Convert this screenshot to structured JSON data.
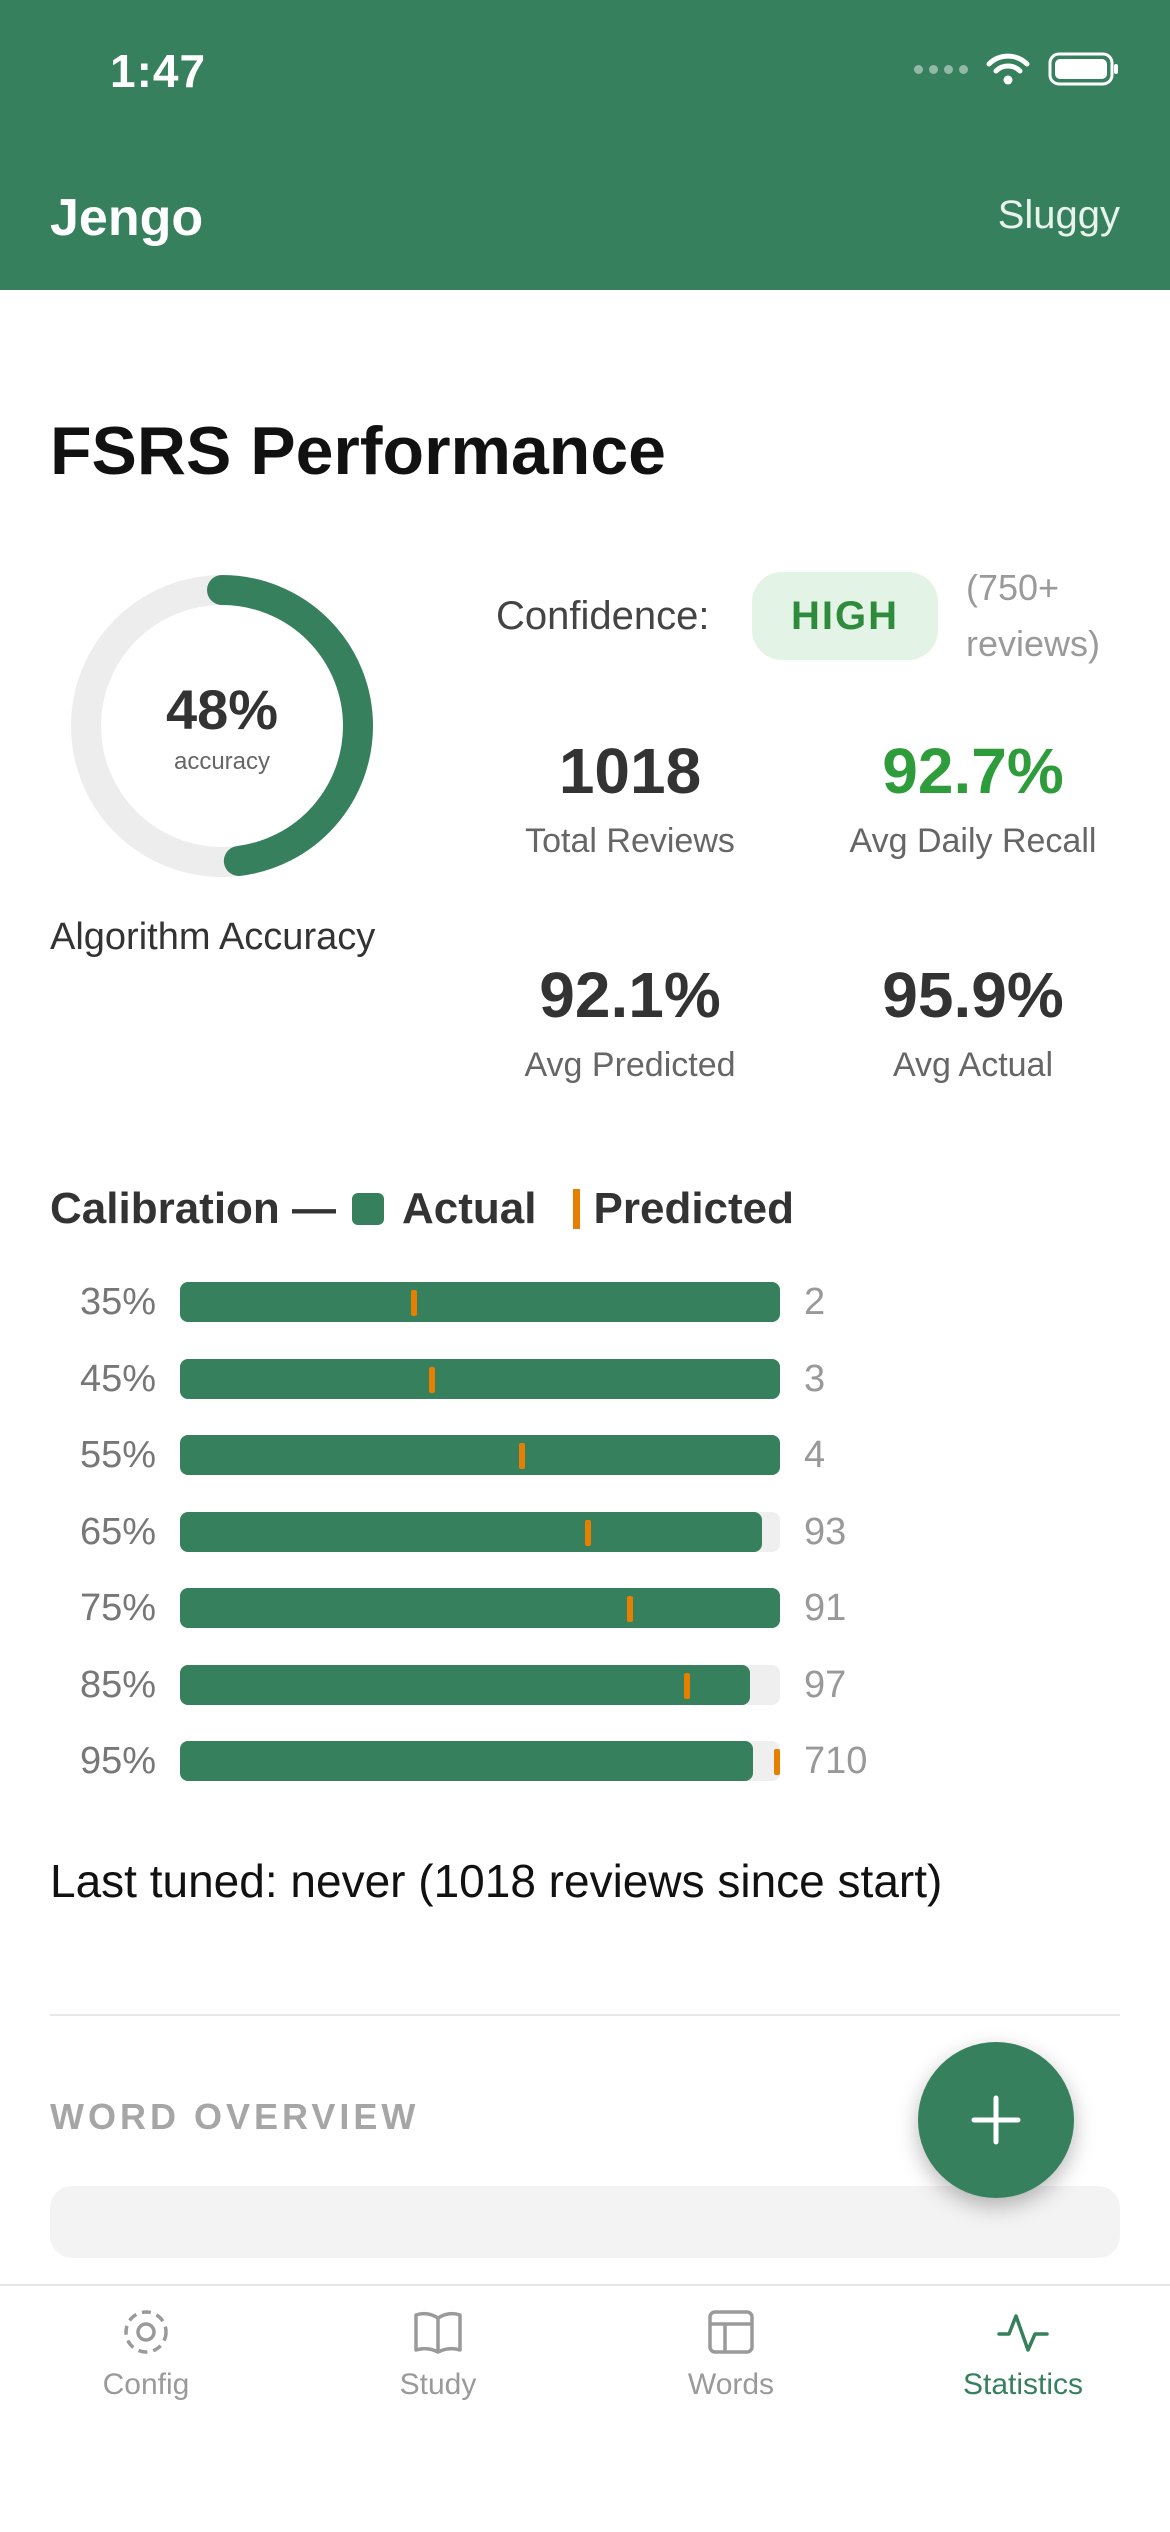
{
  "status_bar": {
    "time": "1:47"
  },
  "header": {
    "app_title": "Jengo",
    "user_name": "Sluggy"
  },
  "page_title": "FSRS Performance",
  "accuracy": {
    "percent": 48,
    "value_label": "48%",
    "sub_label": "accuracy",
    "caption": "Algorithm Accuracy"
  },
  "confidence": {
    "label": "Confidence:",
    "badge": "HIGH",
    "note": "(750+ reviews)"
  },
  "stats": [
    {
      "value": "1018",
      "label": "Total Reviews",
      "highlight": false
    },
    {
      "value": "92.7%",
      "label": "Avg Daily Recall",
      "highlight": true
    },
    {
      "value": "92.1%",
      "label": "Avg Predicted",
      "highlight": false
    },
    {
      "value": "95.9%",
      "label": "Avg Actual",
      "highlight": false
    }
  ],
  "calibration": {
    "title": "Calibration —",
    "legend_actual": "Actual",
    "legend_predicted": "Predicted",
    "bins": [
      {
        "label": "35%",
        "actual": 100,
        "predicted": 39,
        "count": "2"
      },
      {
        "label": "45%",
        "actual": 100,
        "predicted": 42,
        "count": "3"
      },
      {
        "label": "55%",
        "actual": 100,
        "predicted": 57,
        "count": "4"
      },
      {
        "label": "65%",
        "actual": 97,
        "predicted": 68,
        "count": "93"
      },
      {
        "label": "75%",
        "actual": 100,
        "predicted": 75,
        "count": "91"
      },
      {
        "label": "85%",
        "actual": 95,
        "predicted": 84.5,
        "count": "97"
      },
      {
        "label": "95%",
        "actual": 95.5,
        "predicted": 99.5,
        "count": "710"
      }
    ]
  },
  "last_tuned": "Last tuned: never (1018 reviews since start)",
  "word_overview": {
    "title": "WORD OVERVIEW"
  },
  "colors": {
    "primary": "#37805e",
    "predicted": "#e67e00",
    "recall_green": "#2e9c3a"
  },
  "tabs": [
    {
      "label": "Config",
      "icon": "gear-icon",
      "active": false
    },
    {
      "label": "Study",
      "icon": "book-icon",
      "active": false
    },
    {
      "label": "Words",
      "icon": "table-icon",
      "active": false
    },
    {
      "label": "Statistics",
      "icon": "activity-icon",
      "active": true
    }
  ]
}
